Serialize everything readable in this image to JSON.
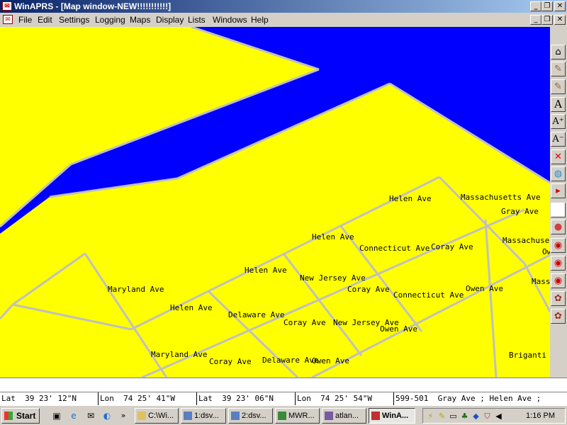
{
  "window": {
    "title": "WinAPRS - [Map window-NEW!!!!!!!!!!!]"
  },
  "menu": [
    "File",
    "Edit",
    "Settings",
    "Logging",
    "Maps",
    "Display",
    "Lists",
    "Windows",
    "Help"
  ],
  "colors": {
    "land": "#ffff00",
    "water": "#0000ff",
    "road": "#c0c0c0",
    "title_bar": "#0a246a"
  },
  "map": {
    "labels": [
      {
        "text": "Helen Ave"
      },
      {
        "text": "Massachusetts Ave"
      },
      {
        "text": "Gray Ave"
      },
      {
        "text": "Helen Ave"
      },
      {
        "text": "Connecticut Ave"
      },
      {
        "text": "Coray Ave"
      },
      {
        "text": "Massachuse"
      },
      {
        "text": "Ow"
      },
      {
        "text": "Helen Ave"
      },
      {
        "text": "New Jersey Ave"
      },
      {
        "text": "Maryland Ave"
      },
      {
        "text": "Coray Ave"
      },
      {
        "text": "Connecticut Ave"
      },
      {
        "text": "Owen Ave"
      },
      {
        "text": "Mass"
      },
      {
        "text": "Helen Ave"
      },
      {
        "text": "Delaware Ave"
      },
      {
        "text": "Coray Ave"
      },
      {
        "text": "New Jersey Ave"
      },
      {
        "text": "Owen Ave"
      },
      {
        "text": "Maryland Ave"
      },
      {
        "text": "Coray Ave"
      },
      {
        "text": "Delaware Ave"
      },
      {
        "text": "Owen Ave"
      },
      {
        "text": "Briganti"
      }
    ]
  },
  "toolbar": [
    {
      "icon": "home-icon",
      "glyph": "⌂"
    },
    {
      "icon": "map-zoom-in-icon",
      "glyph": "✎"
    },
    {
      "icon": "map-zoom-out-icon",
      "glyph": "✎"
    },
    {
      "icon": "font-icon",
      "glyph": "A"
    },
    {
      "icon": "font-larger-icon",
      "glyph": "A⁺"
    },
    {
      "icon": "font-smaller-icon",
      "glyph": "A⁻"
    },
    {
      "icon": "close-red-x-icon",
      "glyph": "✕"
    },
    {
      "icon": "globe-icon",
      "glyph": "◍"
    },
    {
      "icon": "flag-icon",
      "glyph": "▸"
    },
    {
      "icon": "blank-icon",
      "glyph": ""
    },
    {
      "icon": "balloon-icon",
      "glyph": "●"
    },
    {
      "icon": "target-icon-1",
      "glyph": "◉"
    },
    {
      "icon": "target-icon-2",
      "glyph": "◉"
    },
    {
      "icon": "target-icon-3",
      "glyph": "◉"
    },
    {
      "icon": "tree-icon-1",
      "glyph": "✿"
    },
    {
      "icon": "tree-icon-2",
      "glyph": "✿"
    }
  ],
  "status": {
    "lat1": "Lat  39 23' 12\"N",
    "lon1": "Lon  74 25' 41\"W",
    "lat2": "Lat  39 23' 06\"N",
    "lon2": "Lon  74 25' 54\"W",
    "info": "599-501  Gray Ave ; Helen Ave ;"
  },
  "taskbar": {
    "start_label": "Start",
    "tasks": [
      {
        "label": "C:\\Wi...",
        "active": false
      },
      {
        "label": "1:dsv...",
        "active": false
      },
      {
        "label": "2:dsv...",
        "active": false
      },
      {
        "label": "MWR...",
        "active": false
      },
      {
        "label": "atlan...",
        "active": false
      },
      {
        "label": "WinA...",
        "active": true
      }
    ],
    "clock": "1:16 PM"
  }
}
